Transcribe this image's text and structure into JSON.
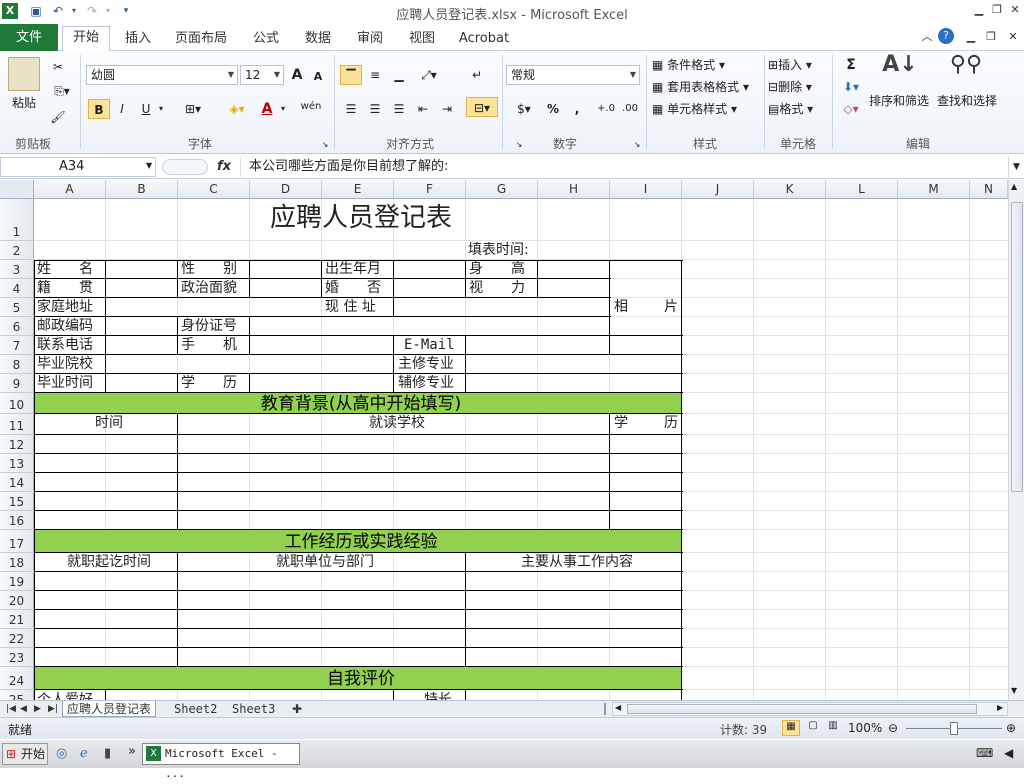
{
  "window": {
    "title": "应聘人员登记表.xlsx - Microsoft Excel"
  },
  "ribbon_tabs": [
    {
      "label": "文件"
    },
    {
      "label": "开始"
    },
    {
      "label": "插入"
    },
    {
      "label": "页面布局"
    },
    {
      "label": "公式"
    },
    {
      "label": "数据"
    },
    {
      "label": "审阅"
    },
    {
      "label": "视图"
    },
    {
      "label": "Acrobat"
    }
  ],
  "ribbon": {
    "clipboard": {
      "label": "剪贴板",
      "paste": "粘贴"
    },
    "font": {
      "label": "字体",
      "name": "幼圆",
      "size": "12",
      "bold": "B",
      "italic": "I",
      "underline": "U",
      "grow": "A",
      "shrink": "A",
      "color_a": "A",
      "wen": "wén"
    },
    "alignment": {
      "label": "对齐方式"
    },
    "number": {
      "label": "数字",
      "format": "常规",
      "percent": "%",
      "comma": ","
    },
    "styles": {
      "label": "样式",
      "conditional": "条件格式",
      "table": "套用表格格式",
      "cell_styles": "单元格样式"
    },
    "cells": {
      "label": "单元格",
      "insert": "插入",
      "delete": "删除",
      "format": "格式"
    },
    "editing": {
      "label": "编辑",
      "sort": "排序和筛选",
      "find": "查找和选择",
      "sigma": "Σ"
    }
  },
  "formula_bar": {
    "name_box": "A34",
    "fx": "fx",
    "content": "本公司哪些方面是你目前想了解的:"
  },
  "columns": [
    "A",
    "B",
    "C",
    "D",
    "E",
    "F",
    "G",
    "H",
    "I",
    "J",
    "K",
    "L",
    "M",
    "N"
  ],
  "rows": [
    "1",
    "2",
    "3",
    "4",
    "5",
    "6",
    "7",
    "8",
    "9",
    "10",
    "11",
    "12",
    "13",
    "14",
    "15",
    "16",
    "17",
    "18",
    "19",
    "20",
    "21",
    "22",
    "23",
    "24",
    "25"
  ],
  "form": {
    "title": "应聘人员登记表",
    "fill_time": "填表时间:",
    "name": "姓　　名",
    "gender": "性　　别",
    "birth": "出生年月",
    "height": "身　　高",
    "origin": "籍　　贯",
    "politics": "政治面貌",
    "marital": "婚　　否",
    "vision": "视　　力",
    "address": "家庭地址",
    "current_addr": "现 住 址",
    "photo_l": "相",
    "photo_r": "片",
    "postcode": "邮政编码",
    "id_no": "身份证号",
    "phone": "联系电话",
    "mobile": "手　　机",
    "email": "E-Mail",
    "school": "毕业院校",
    "major": "主修专业",
    "grad_time": "毕业时间",
    "degree": "学　　历",
    "minor": "辅修专业",
    "edu_section": "教育背景(从高中开始填写)",
    "edu_time": "时间",
    "edu_school": "就读学校",
    "edu_degree_l": "学",
    "edu_degree_r": "历",
    "work_section": "工作经历或实践经验",
    "work_time": "就职起讫时间",
    "work_unit": "就职单位与部门",
    "work_content": "主要从事工作内容",
    "self_section": "自我评价",
    "hobby": "个人爱好",
    "speciality": "特长"
  },
  "sheet_tabs": [
    {
      "label": "应聘人员登记表"
    },
    {
      "label": "Sheet2"
    },
    {
      "label": "Sheet3"
    }
  ],
  "status": {
    "ready": "就绪",
    "count": "计数: 39",
    "zoom": "100%"
  },
  "taskbar": {
    "start": "开始",
    "task": "Microsoft Excel - ..."
  },
  "colors": {
    "accent_green": "#92d050",
    "file_tab": "#1f7a3a"
  }
}
